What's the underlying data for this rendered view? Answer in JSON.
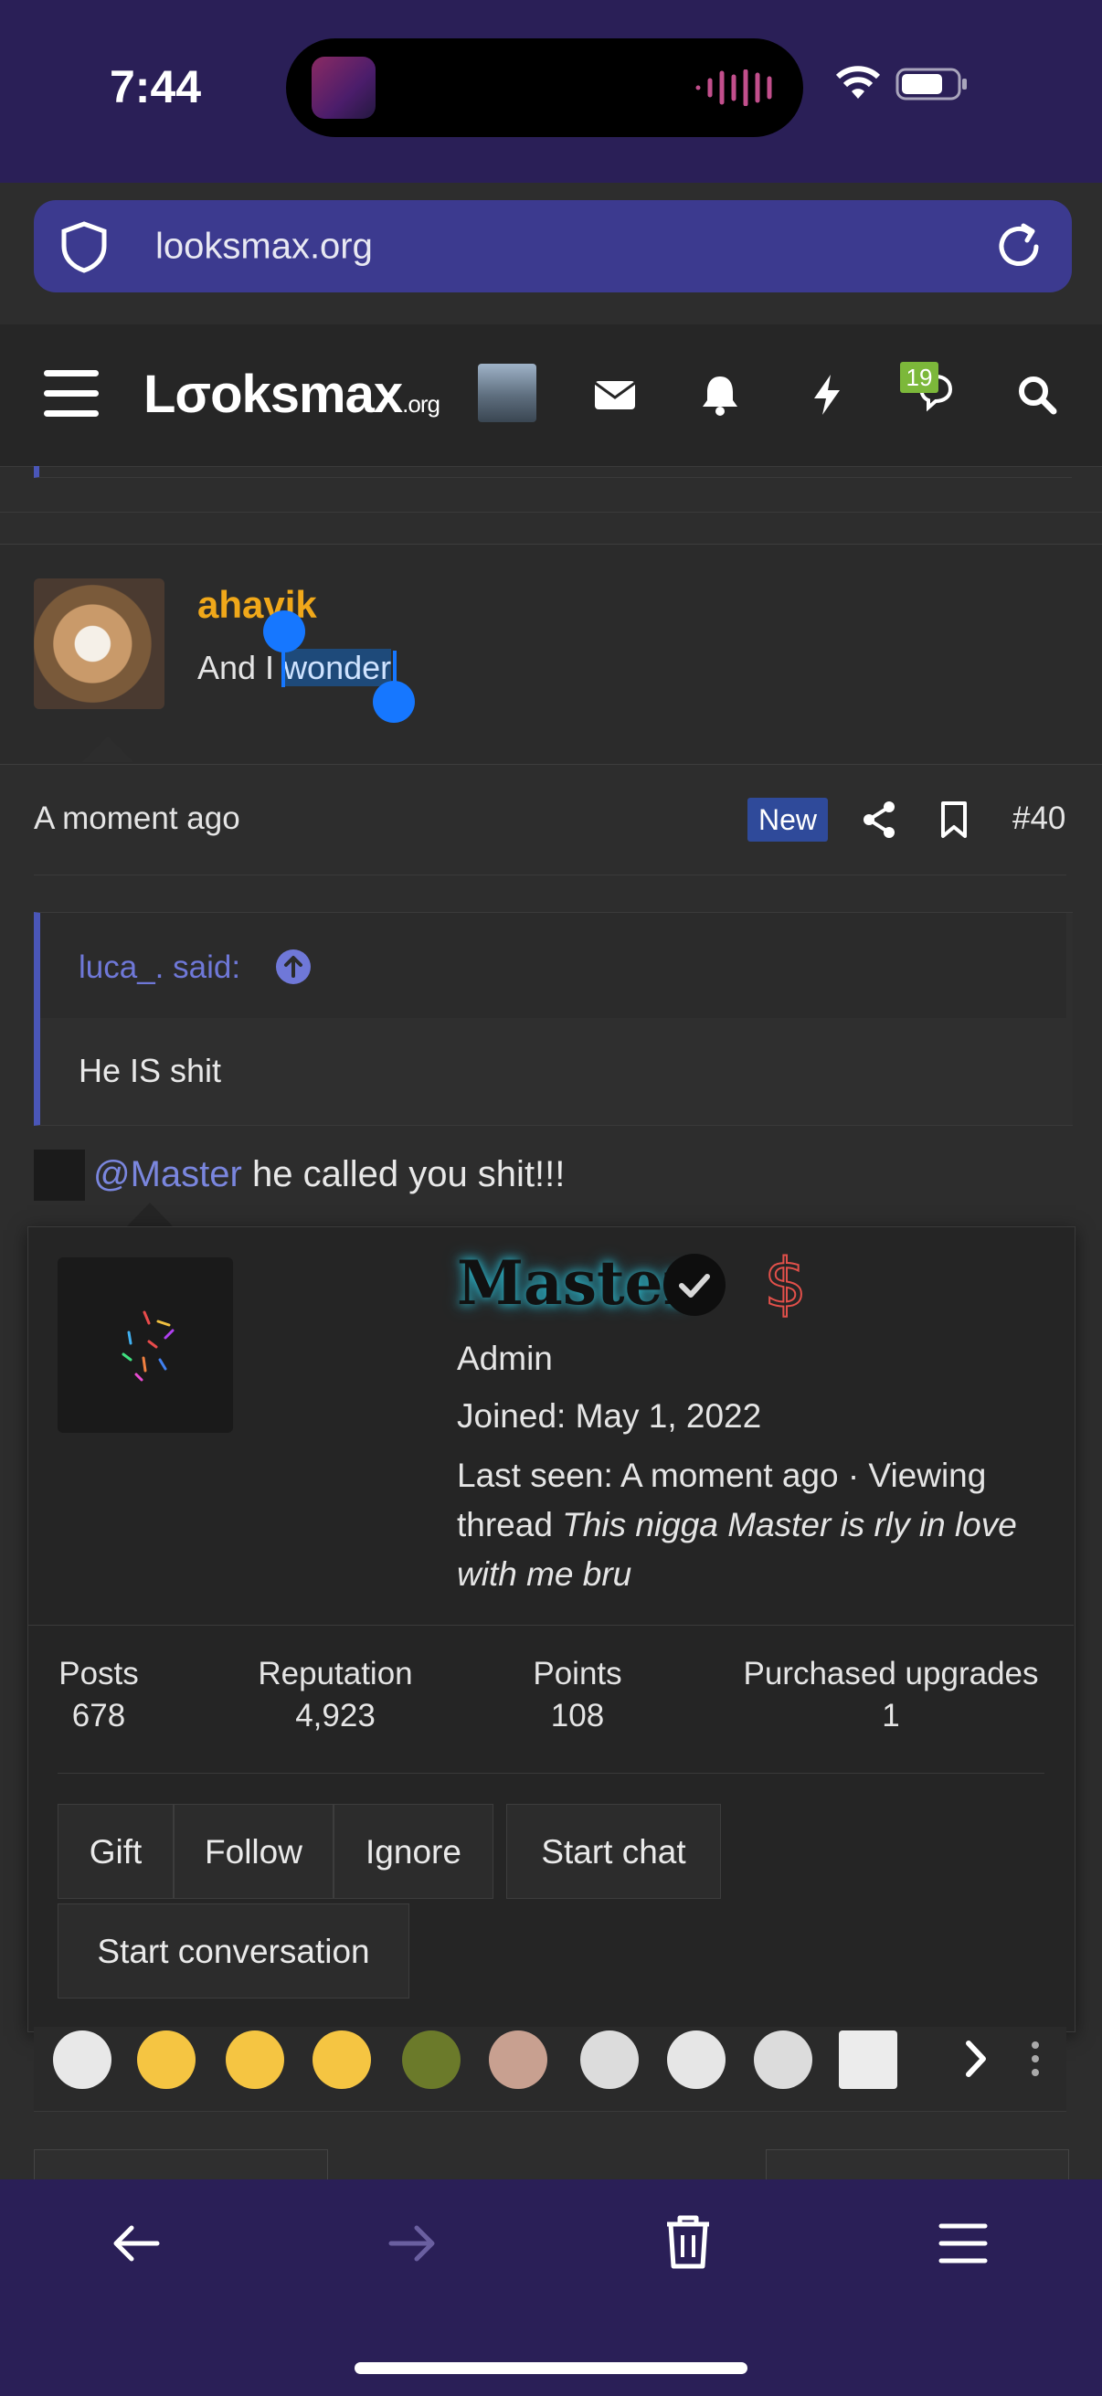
{
  "status_bar": {
    "time": "7:44"
  },
  "browser": {
    "url": "looksmax.org"
  },
  "header": {
    "logo_main": "Lσoksmax",
    "logo_suffix": ".org",
    "conversation_badge": "19"
  },
  "post": {
    "username": "ahavik",
    "user_title_before": "And I ",
    "user_title_selected": "wonder",
    "timestamp": "A moment ago",
    "new_badge": "New",
    "post_number": "#40",
    "quote_author": "luca_. said:",
    "quote_text": "He IS shit",
    "mention": "@Master",
    "message_rest": " he called you shit!!!"
  },
  "member_popup": {
    "name": "Master",
    "role": "Admin",
    "joined": "Joined: May 1, 2022",
    "last_seen_prefix": "Last seen: A moment ago · Viewing thread ",
    "last_seen_thread": "This nigga Master is rly in love with me bru",
    "stats": [
      {
        "label": "Posts",
        "value": "678"
      },
      {
        "label": "Reputation",
        "value": "4,923"
      },
      {
        "label": "Points",
        "value": "108"
      },
      {
        "label": "Purchased upgrades",
        "value": "1"
      }
    ],
    "actions": [
      "Gift",
      "Follow",
      "Ignore",
      "Start chat",
      "Start conversation"
    ]
  },
  "colors": {
    "accent_username": "#f0a81a",
    "link": "#7a86de",
    "browser_chrome": "#2a1f57",
    "new_badge": "#2f4a9a"
  }
}
